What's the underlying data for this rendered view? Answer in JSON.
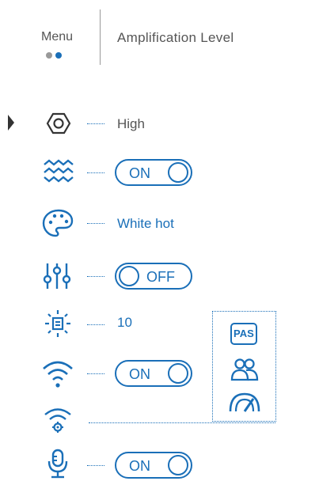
{
  "header": {
    "menu_label": "Menu",
    "title": "Amplification Level",
    "page_dots": [
      "inactive",
      "active"
    ]
  },
  "colors": {
    "accent": "#1a6fb8",
    "inactive_dot": "#999999",
    "text_gray": "#555555"
  },
  "rows": [
    {
      "icon": "hexagon-nut-icon",
      "value": "High",
      "selected": true
    },
    {
      "icon": "waves-icon",
      "toggle": "ON"
    },
    {
      "icon": "palette-icon",
      "value": "White hot"
    },
    {
      "icon": "sliders-icon",
      "toggle": "OFF"
    },
    {
      "icon": "brightness-display-icon",
      "value": "10"
    },
    {
      "icon": "wifi-icon",
      "toggle": "ON"
    },
    {
      "icon": "wifi-settings-icon"
    },
    {
      "icon": "microphone-icon",
      "toggle": "ON"
    }
  ],
  "side_panel": {
    "pas_label": "PAS",
    "icons": [
      "pas-icon",
      "users-icon",
      "gauge-icon"
    ]
  }
}
